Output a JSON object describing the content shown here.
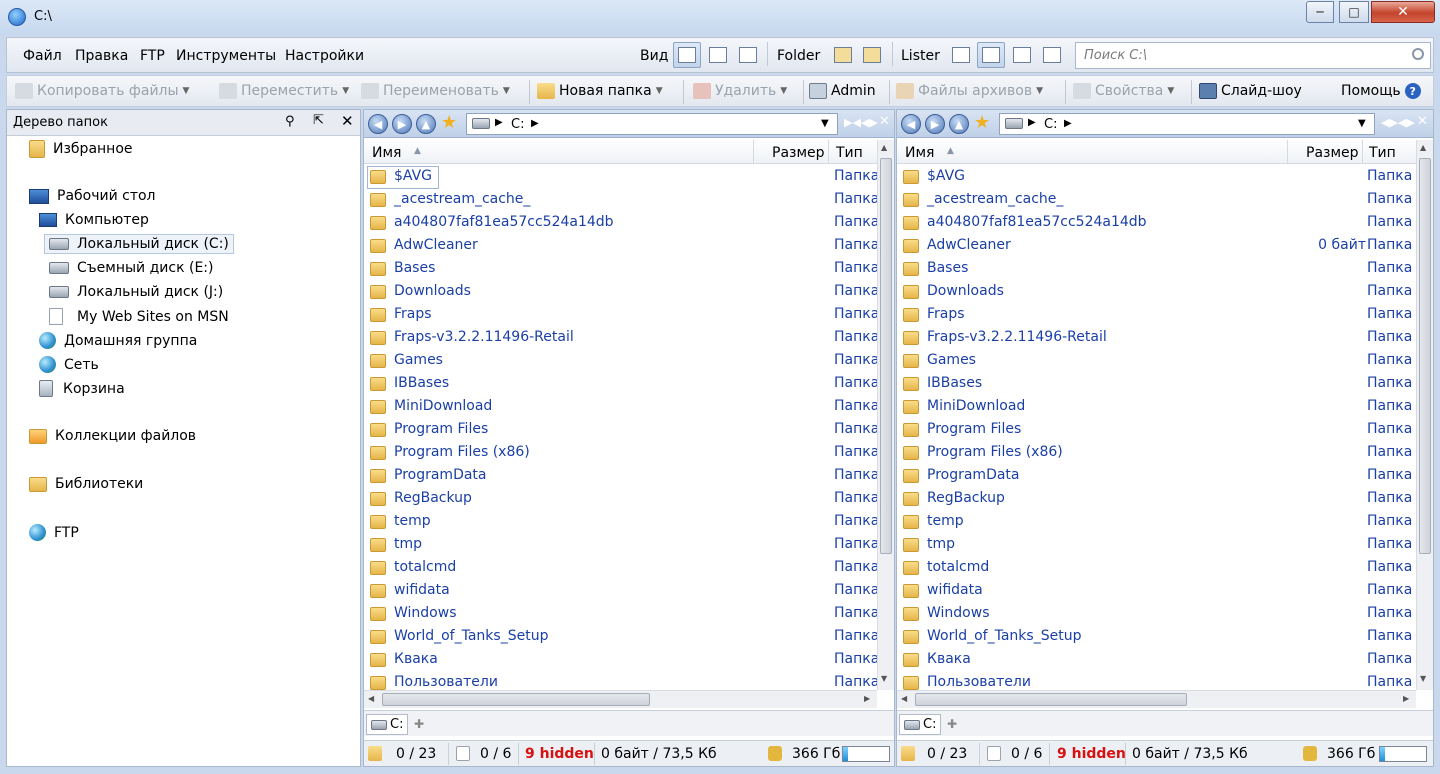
{
  "window": {
    "title": "C:\\"
  },
  "menu": [
    "Файл",
    "Правка",
    "FTP",
    "Инструменты",
    "Настройки"
  ],
  "viewbar": {
    "view_label": "Вид",
    "folder_label": "Folder",
    "lister_label": "Lister"
  },
  "search": {
    "placeholder": "Поиск C:\\"
  },
  "toolbar": {
    "copy": "Копировать файлы",
    "move": "Переместить",
    "rename": "Переименовать",
    "new_folder": "Новая папка",
    "delete": "Удалить",
    "admin": "Admin",
    "archives": "Файлы архивов",
    "properties": "Свойства",
    "slideshow": "Слайд-шоу",
    "help": "Помощь"
  },
  "tree": {
    "title": "Дерево папок",
    "items": [
      {
        "label": "Избранное"
      },
      {
        "label": "Рабочий стол"
      },
      {
        "label": "Компьютер"
      },
      {
        "label": "Локальный диск (C:)"
      },
      {
        "label": "Съемный диск (E:)"
      },
      {
        "label": "Локальный диск (J:)"
      },
      {
        "label": "My Web Sites on MSN"
      },
      {
        "label": "Домашняя группа"
      },
      {
        "label": "Сеть"
      },
      {
        "label": "Корзина"
      },
      {
        "label": "Коллекции файлов"
      },
      {
        "label": "Библиотеки"
      },
      {
        "label": "FTP"
      }
    ]
  },
  "columns": {
    "name": "Имя",
    "size": "Размер",
    "type": "Тип"
  },
  "left": {
    "path": "C:",
    "tab": "C:",
    "rows": [
      {
        "name": "$AVG",
        "size": "",
        "type": "Папка"
      },
      {
        "name": "_acestream_cache_",
        "size": "",
        "type": "Папка"
      },
      {
        "name": "a404807faf81ea57cc524a14db",
        "size": "",
        "type": "Папка"
      },
      {
        "name": "AdwCleaner",
        "size": "",
        "type": "Папка"
      },
      {
        "name": "Bases",
        "size": "",
        "type": "Папка"
      },
      {
        "name": "Downloads",
        "size": "",
        "type": "Папка"
      },
      {
        "name": "Fraps",
        "size": "",
        "type": "Папка"
      },
      {
        "name": "Fraps-v3.2.2.11496-Retail",
        "size": "",
        "type": "Папка"
      },
      {
        "name": "Games",
        "size": "",
        "type": "Папка"
      },
      {
        "name": "IBBases",
        "size": "",
        "type": "Папка"
      },
      {
        "name": "MiniDownload",
        "size": "",
        "type": "Папка"
      },
      {
        "name": "Program Files",
        "size": "",
        "type": "Папка"
      },
      {
        "name": "Program Files (x86)",
        "size": "",
        "type": "Папка"
      },
      {
        "name": "ProgramData",
        "size": "",
        "type": "Папка"
      },
      {
        "name": "RegBackup",
        "size": "",
        "type": "Папка"
      },
      {
        "name": "temp",
        "size": "",
        "type": "Папка"
      },
      {
        "name": "tmp",
        "size": "",
        "type": "Папка"
      },
      {
        "name": "totalcmd",
        "size": "",
        "type": "Папка"
      },
      {
        "name": "wifidata",
        "size": "",
        "type": "Папка"
      },
      {
        "name": "Windows",
        "size": "",
        "type": "Папка"
      },
      {
        "name": "World_of_Tanks_Setup",
        "size": "",
        "type": "Папка"
      },
      {
        "name": "Квака",
        "size": "",
        "type": "Папка"
      },
      {
        "name": "Пользователи",
        "size": "",
        "type": "Папка"
      }
    ],
    "status": {
      "folders": "0 / 23",
      "files": "0 / 6",
      "hidden": "9 hidden",
      "bytes": "0 байт / 73,5 Кб",
      "free": "366 Гб",
      "free_fraction": 0.1
    }
  },
  "right": {
    "path": "C:",
    "tab": "C:",
    "rows": [
      {
        "name": "$AVG",
        "size": "",
        "type": "Папка"
      },
      {
        "name": "_acestream_cache_",
        "size": "",
        "type": "Папка"
      },
      {
        "name": "a404807faf81ea57cc524a14db",
        "size": "",
        "type": "Папка"
      },
      {
        "name": "AdwCleaner",
        "size": "0 байт",
        "type": "Папка"
      },
      {
        "name": "Bases",
        "size": "",
        "type": "Папка"
      },
      {
        "name": "Downloads",
        "size": "",
        "type": "Папка"
      },
      {
        "name": "Fraps",
        "size": "",
        "type": "Папка"
      },
      {
        "name": "Fraps-v3.2.2.11496-Retail",
        "size": "",
        "type": "Папка"
      },
      {
        "name": "Games",
        "size": "",
        "type": "Папка"
      },
      {
        "name": "IBBases",
        "size": "",
        "type": "Папка"
      },
      {
        "name": "MiniDownload",
        "size": "",
        "type": "Папка"
      },
      {
        "name": "Program Files",
        "size": "",
        "type": "Папка"
      },
      {
        "name": "Program Files (x86)",
        "size": "",
        "type": "Папка"
      },
      {
        "name": "ProgramData",
        "size": "",
        "type": "Папка"
      },
      {
        "name": "RegBackup",
        "size": "",
        "type": "Папка"
      },
      {
        "name": "temp",
        "size": "",
        "type": "Папка"
      },
      {
        "name": "tmp",
        "size": "",
        "type": "Папка"
      },
      {
        "name": "totalcmd",
        "size": "",
        "type": "Папка"
      },
      {
        "name": "wifidata",
        "size": "",
        "type": "Папка"
      },
      {
        "name": "Windows",
        "size": "",
        "type": "Папка"
      },
      {
        "name": "World_of_Tanks_Setup",
        "size": "",
        "type": "Папка"
      },
      {
        "name": "Квака",
        "size": "",
        "type": "Папка"
      },
      {
        "name": "Пользователи",
        "size": "",
        "type": "Папка"
      }
    ],
    "status": {
      "folders": "0 / 23",
      "files": "0 / 6",
      "hidden": "9 hidden",
      "bytes": "0 байт / 73,5 Кб",
      "free": "366 Гб",
      "free_fraction": 0.1
    }
  },
  "colors": {
    "link": "#1a3fa6",
    "hidden": "#d81010",
    "folder": "#e6b54a"
  }
}
